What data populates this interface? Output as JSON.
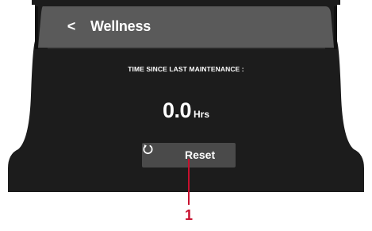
{
  "header": {
    "back_glyph": "<",
    "title": "Wellness"
  },
  "maintenance": {
    "label": "TIME SINCE LAST MAINTENANCE :",
    "value": "0.0",
    "unit": "Hrs"
  },
  "reset_button": {
    "label": "Reset",
    "icon": "reset-icon"
  },
  "callout": {
    "number": "1"
  },
  "colors": {
    "screen": "#1c1c1c",
    "header_bar": "#5e5e5e",
    "button": "#4a4a4a",
    "callout": "#c8102e",
    "text": "#ffffff"
  }
}
